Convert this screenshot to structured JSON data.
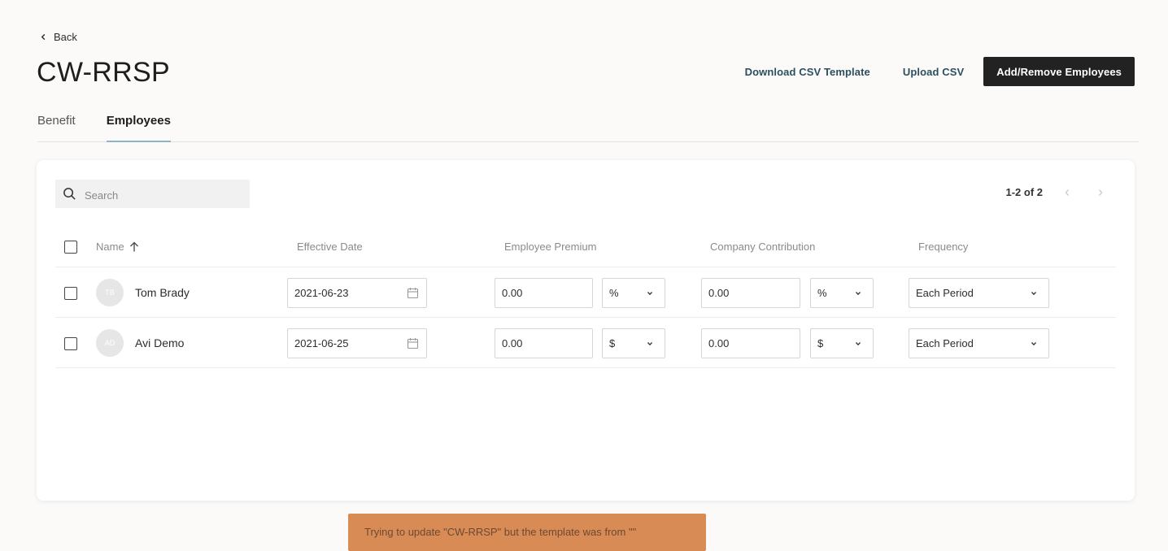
{
  "nav": {
    "back_label": "Back"
  },
  "page": {
    "title": "CW-RRSP"
  },
  "actions": {
    "download_label": "Download CSV Template",
    "upload_label": "Upload CSV",
    "add_remove_label": "Add/Remove Employees"
  },
  "tabs": [
    {
      "label": "Benefit",
      "active": false
    },
    {
      "label": "Employees",
      "active": true
    }
  ],
  "search": {
    "placeholder": "Search",
    "value": ""
  },
  "pagination": {
    "range_label": "1-2 of 2"
  },
  "table": {
    "columns": {
      "name": "Name",
      "effective_date": "Effective Date",
      "employee_premium": "Employee Premium",
      "company_contribution": "Company Contribution",
      "frequency": "Frequency"
    },
    "rows": [
      {
        "initials": "TB",
        "name": "Tom Brady",
        "effective_date": "2021-06-23",
        "employee_premium": "0.00",
        "employee_premium_unit": "%",
        "company_contribution": "0.00",
        "company_contribution_unit": "%",
        "frequency": "Each Period"
      },
      {
        "initials": "AD",
        "name": "Avi Demo",
        "effective_date": "2021-06-25",
        "employee_premium": "0.00",
        "employee_premium_unit": "$",
        "company_contribution": "0.00",
        "company_contribution_unit": "$",
        "frequency": "Each Period"
      }
    ]
  },
  "toast": {
    "message": "Trying to update \"CW-RRSP\" but the template was from \"\""
  },
  "colors": {
    "background": "#fbfaf9",
    "primary_button": "#222222",
    "link": "#2c4e5e",
    "tab_underline": "#8fb5c4",
    "toast": "#d98b55"
  }
}
